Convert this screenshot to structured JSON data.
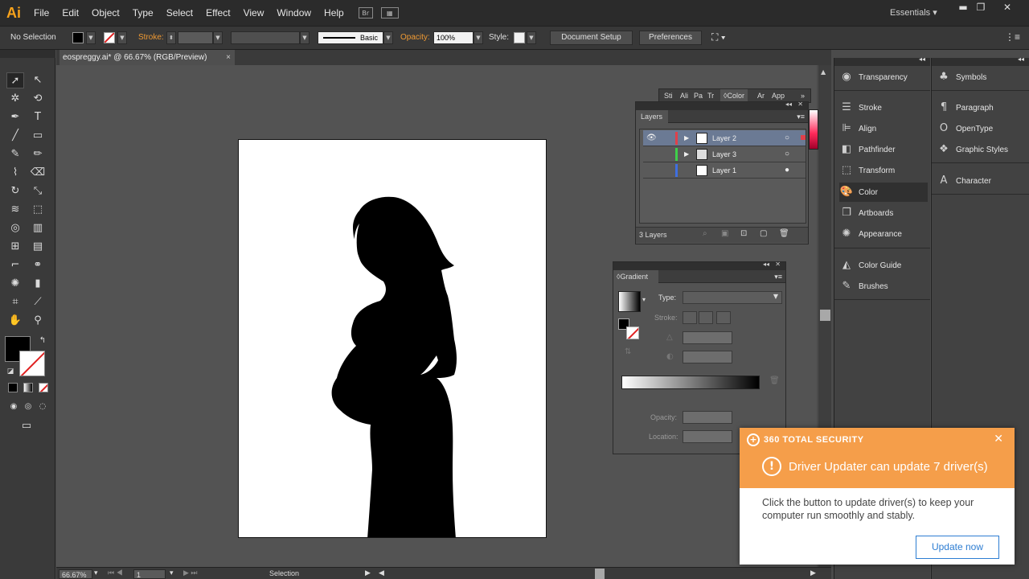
{
  "app": {
    "logo": "Ai",
    "workspace": "Essentials"
  },
  "menu": [
    "File",
    "Edit",
    "Object",
    "Type",
    "Select",
    "Effect",
    "View",
    "Window",
    "Help"
  ],
  "menu_icons": {
    "bridge": "Br"
  },
  "control_bar": {
    "selection": "No Selection",
    "stroke_label": "Stroke:",
    "brush_def": "Basic",
    "opacity_label": "Opacity:",
    "opacity_value": "100%",
    "style_label": "Style:",
    "doc_setup": "Document Setup",
    "preferences": "Preferences"
  },
  "document": {
    "tab_title": "eospreggy.ai* @ 66.67% (RGB/Preview)",
    "close": "×"
  },
  "status": {
    "zoom": "66.67%",
    "artboard": "1",
    "tool": "Selection"
  },
  "layers_panel": {
    "stack_tabs": [
      "Sti",
      "Ali",
      "Pa",
      "Tr",
      "Color",
      "Ar",
      "App"
    ],
    "title": "Layers",
    "layers": [
      {
        "name": "Layer 2",
        "color": "#e0404a",
        "selected": true
      },
      {
        "name": "Layer 3",
        "color": "#3fcf4a",
        "selected": false
      },
      {
        "name": "Layer 1",
        "color": "#3f6fe0",
        "selected": false
      }
    ],
    "count": "3 Layers"
  },
  "gradient_panel": {
    "title": "Gradient",
    "type_label": "Type:",
    "stroke_label": "Stroke:",
    "opacity_label": "Opacity:",
    "location_label": "Location:"
  },
  "dock_col1": [
    "Transparency",
    "Stroke",
    "Align",
    "Pathfinder",
    "Transform",
    "Color",
    "Artboards",
    "Appearance",
    "Color Guide",
    "Brushes"
  ],
  "dock_col2": [
    "Symbols",
    "Paragraph",
    "OpenType",
    "Graphic Styles",
    "Character"
  ],
  "notification": {
    "brand": "360 TOTAL SECURITY",
    "title": "Driver Updater can update 7 driver(s)",
    "body": "Click the button to update driver(s) to keep your computer run smoothly and stably.",
    "button": "Update now",
    "header_color": "#f59e4a"
  }
}
